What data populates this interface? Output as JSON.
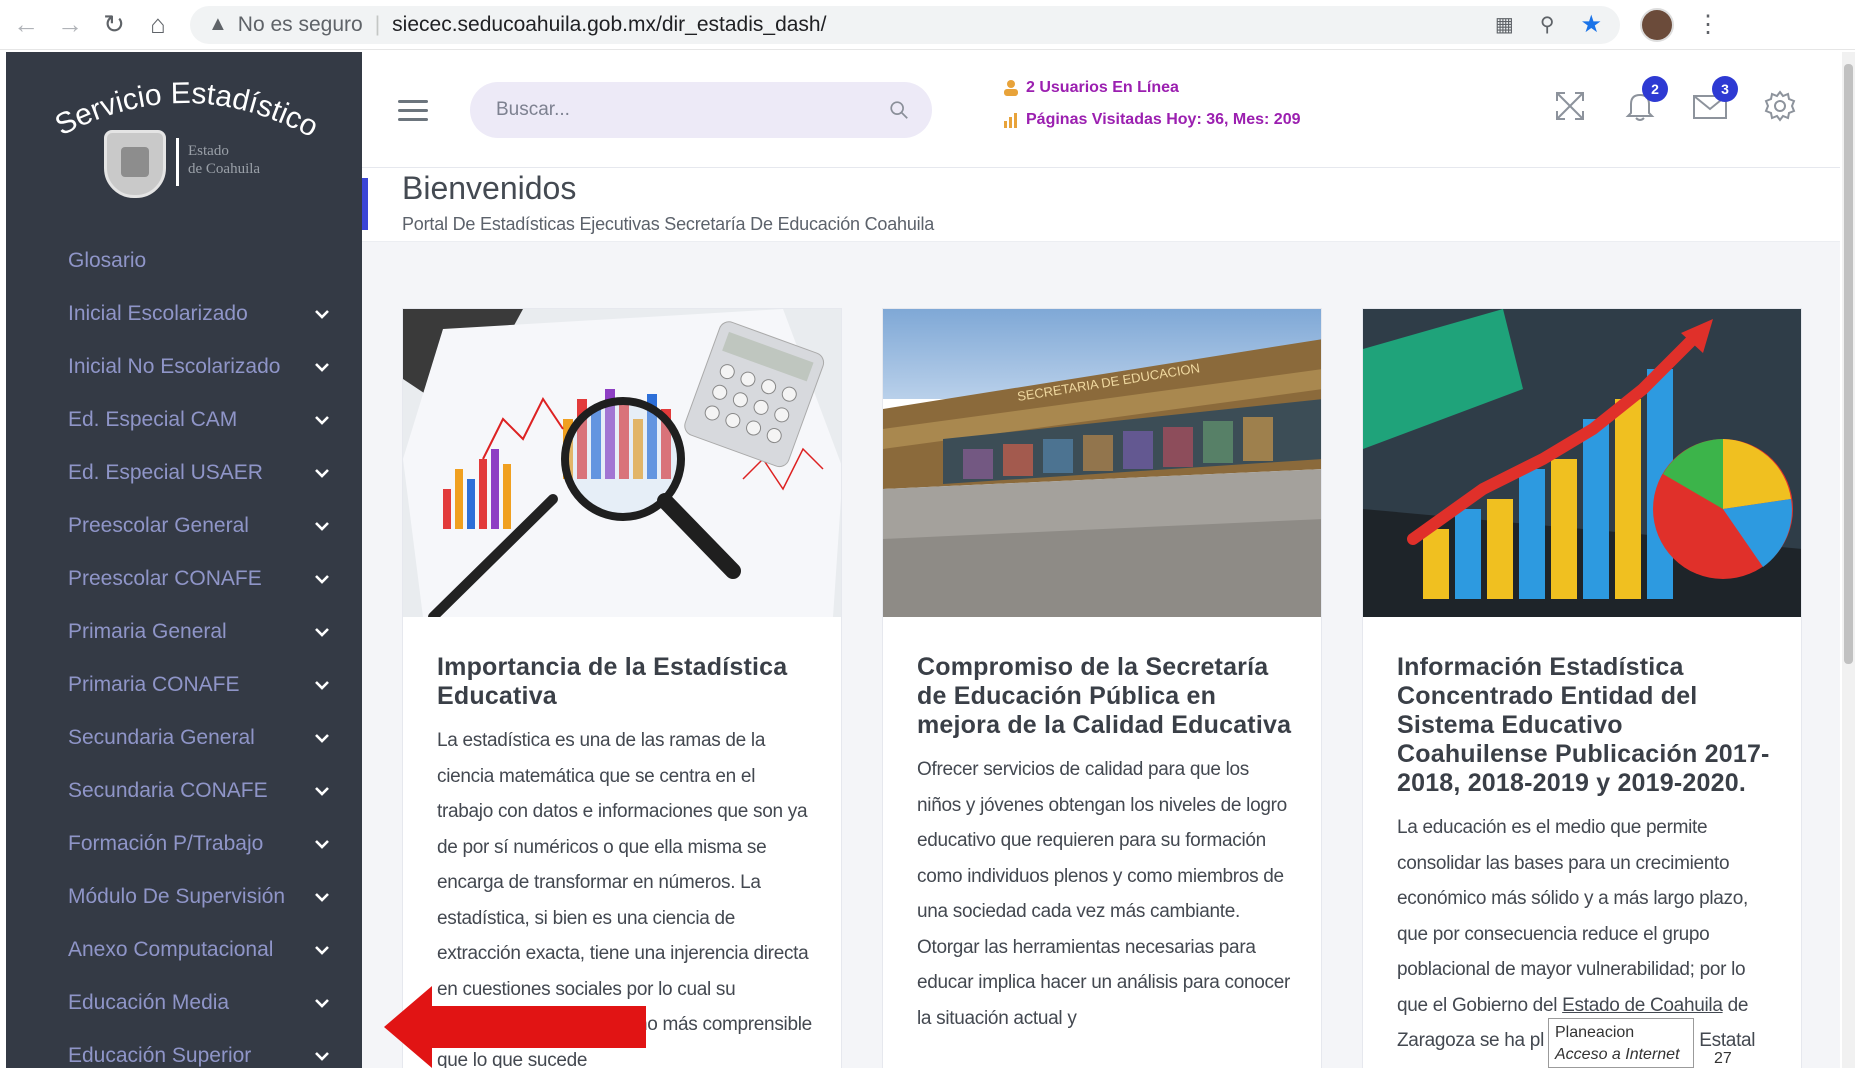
{
  "browser": {
    "security_label": "No es seguro",
    "url": "siecec.seducoahuila.gob.mx/dir_estadis_dash/"
  },
  "logo": {
    "title": "Servicio Estadístico",
    "sub_line1": "Estado",
    "sub_line2": "de Coahuila"
  },
  "sidebar": {
    "items": [
      {
        "label": "Glosario",
        "expandable": false
      },
      {
        "label": "Inicial Escolarizado",
        "expandable": true
      },
      {
        "label": "Inicial No Escolarizado",
        "expandable": true
      },
      {
        "label": "Ed. Especial CAM",
        "expandable": true
      },
      {
        "label": "Ed. Especial USAER",
        "expandable": true
      },
      {
        "label": "Preescolar General",
        "expandable": true
      },
      {
        "label": "Preescolar CONAFE",
        "expandable": true
      },
      {
        "label": "Primaria General",
        "expandable": true
      },
      {
        "label": "Primaria CONAFE",
        "expandable": true
      },
      {
        "label": "Secundaria General",
        "expandable": true
      },
      {
        "label": "Secundaria CONAFE",
        "expandable": true
      },
      {
        "label": "Formación P/Trabajo",
        "expandable": true
      },
      {
        "label": "Módulo De Supervisión",
        "expandable": true
      },
      {
        "label": "Anexo Computacional",
        "expandable": true
      },
      {
        "label": "Educación Media",
        "expandable": true
      },
      {
        "label": "Educación Superior",
        "expandable": true
      }
    ]
  },
  "header": {
    "search_placeholder": "Buscar...",
    "users_online": "2 Usuarios En Línea",
    "page_visits": "Páginas Visitadas Hoy: 36, Mes: 209",
    "notifications_count": "2",
    "messages_count": "3"
  },
  "page": {
    "title": "Bienvenidos",
    "subtitle": "Portal De Estadísticas Ejecutivas Secretaría De Educación Coahuila"
  },
  "cards": [
    {
      "title": "Importancia de la Estadística Educativa",
      "text": "La estadística es una de las ramas de la ciencia matemática que se centra en el trabajo con datos e informaciones que son ya de por sí numéricos o que ella misma se encarga de transformar en números. La estadística, si bien es una ciencia de extracción exacta, tiene una injerencia directa en cuestiones sociales por lo cual su",
      "text_partial": "no más",
      "text_last": "comprensible que lo que sucede"
    },
    {
      "title": "Compromiso de la Secretaría de Educación Pública en mejora de la Calidad Educativa",
      "text": "Ofrecer servicios de calidad para que los niños y jóvenes obtengan los niveles de logro educativo que requieren para su formación como individuos plenos y como miembros de una sociedad cada vez más cambiante. Otorgar las herramientas necesarias para educar implica hacer un análisis para conocer la situación actual y",
      "image_sign": "SECRETARIA DE EDUCACION"
    },
    {
      "title": "Información Estadística Concentrado Entidad del Sistema Educativo Coahuilense Publicación 2017-2018, 2018-2019 y 2019-2020.",
      "text_a": "La educación es el medio que permite consolidar las bases para un crecimiento económico más sólido y a más largo plazo, que por consecuencia reduce el grupo poblacional de mayor vulnerabilidad; por lo que el Gobierno del",
      "text_link": "Estado de Coahuila",
      "text_b": "de Zaragoza se ha pl",
      "text_c": "n Estatal"
    }
  ],
  "tooltip": {
    "line1": "Planeacion",
    "line2": "Acceso a Internet",
    "line3": "27"
  }
}
